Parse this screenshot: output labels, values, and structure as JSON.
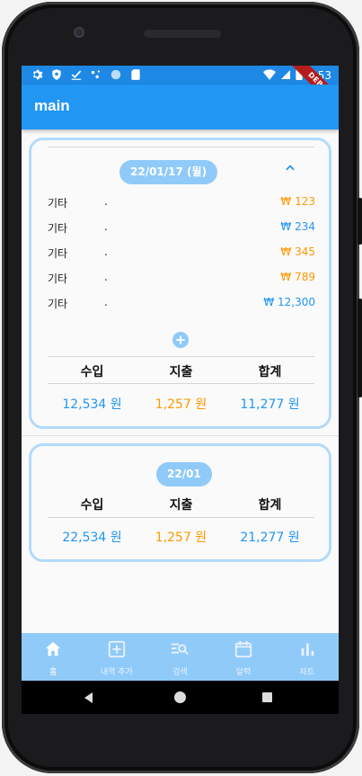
{
  "statusbar": {
    "time": "1:53",
    "debug_label": "DEBUG"
  },
  "appbar": {
    "title": "main"
  },
  "daily_card": {
    "date": "22/01/17 (월)",
    "entries": [
      {
        "category": "기타",
        "memo": ".",
        "amount": "₩ 123",
        "type": "expense"
      },
      {
        "category": "기타",
        "memo": ".",
        "amount": "₩ 234",
        "type": "income"
      },
      {
        "category": "기타",
        "memo": ".",
        "amount": "₩ 345",
        "type": "expense"
      },
      {
        "category": "기타",
        "memo": ".",
        "amount": "₩ 789",
        "type": "expense"
      },
      {
        "category": "기타",
        "memo": ".",
        "amount": "₩ 12,300",
        "type": "income"
      }
    ],
    "summary": {
      "income_label": "수입",
      "expense_label": "지출",
      "total_label": "합계",
      "income": "12,534 원",
      "expense": "1,257 원",
      "total": "11,277 원"
    }
  },
  "monthly_card": {
    "month": "22/01",
    "summary": {
      "income_label": "수입",
      "expense_label": "지출",
      "total_label": "합계",
      "income": "22,534 원",
      "expense": "1,257 원",
      "total": "21,277 원"
    }
  },
  "bottom_nav": {
    "items": [
      {
        "label": "홈",
        "icon": "home-icon",
        "active": true
      },
      {
        "label": "내역 추가",
        "icon": "add-box-icon",
        "active": false
      },
      {
        "label": "검색",
        "icon": "search-list-icon",
        "active": false
      },
      {
        "label": "달력",
        "icon": "calendar-icon",
        "active": false
      },
      {
        "label": "차트",
        "icon": "bar-chart-icon",
        "active": false
      }
    ]
  },
  "colors": {
    "primary": "#2196f3",
    "light_primary": "#90caf9",
    "card_border": "#b3dafb",
    "expense": "#ff9800",
    "income": "#2196f3"
  }
}
